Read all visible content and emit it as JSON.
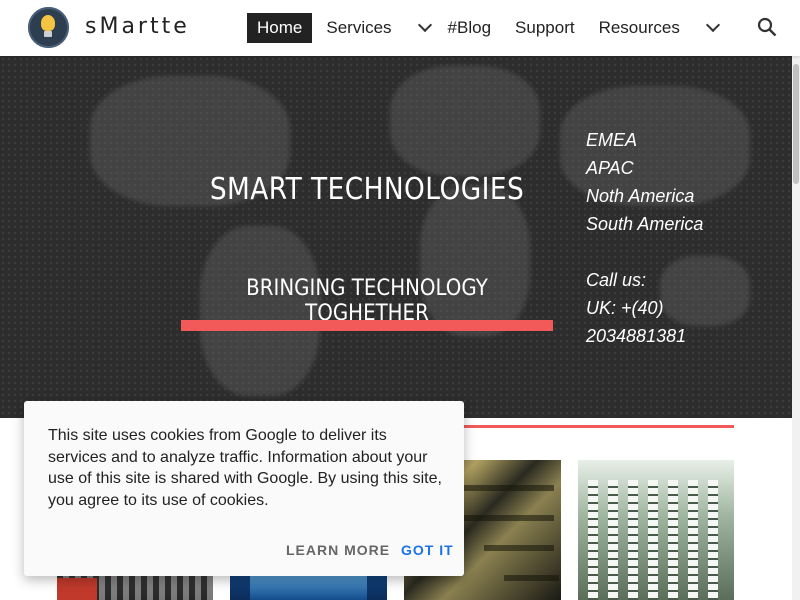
{
  "header": {
    "site_title": "sMartte",
    "nav": [
      {
        "label": "Home",
        "active": true
      },
      {
        "label": "Services",
        "has_dropdown": true
      },
      {
        "label": "#Blog"
      },
      {
        "label": "Support"
      },
      {
        "label": "Resources",
        "has_dropdown": true
      }
    ],
    "search_icon": "search-icon",
    "logo_icon": "lightbulb-icon"
  },
  "hero": {
    "title": "SMART TECHNOLOGIES",
    "subtitle": "BRINGING TECHNOLOGY TOGHETHER",
    "regions": [
      "EMEA",
      "APAC",
      "Noth America",
      "South America"
    ],
    "call_label": "Call us:",
    "phone_line1": "UK: +(40)",
    "phone_line2": "2034881381",
    "accent_color": "#f25a5a"
  },
  "cookie_notice": {
    "text": "This site uses cookies from Google to deliver its services and to analyze traffic. Information about your use of this site is shared with Google. By using this site, you agree to its use of cookies.",
    "learn_more": "LEARN MORE",
    "got_it": "GOT IT"
  }
}
